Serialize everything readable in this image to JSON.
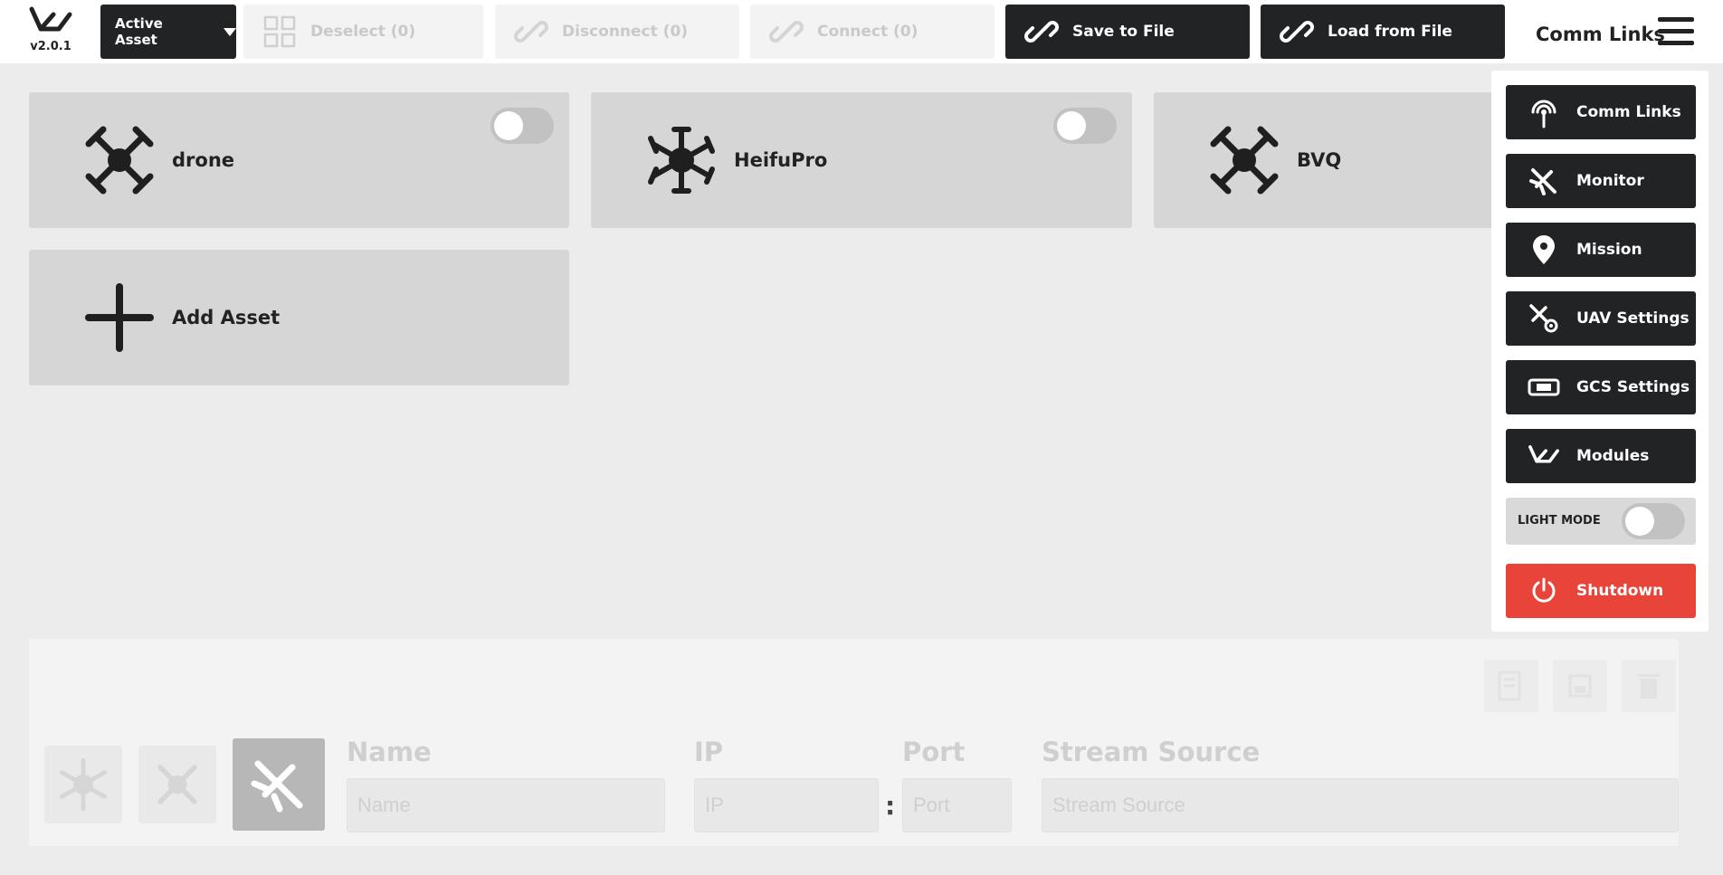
{
  "app": {
    "version": "v2.0.1"
  },
  "topbar": {
    "active_asset_label": "Active Asset",
    "deselect_label": "Deselect (0)",
    "disconnect_label": "Disconnect (0)",
    "connect_label": "Connect (0)",
    "save_label": "Save to File",
    "load_label": "Load from File",
    "menu_title": "Comm Links"
  },
  "assets": [
    {
      "name": "drone",
      "icon": "quadcopter-icon",
      "enabled": false
    },
    {
      "name": "HeifuPro",
      "icon": "hexacopter-icon",
      "enabled": false
    },
    {
      "name": "BVQ",
      "icon": "quadcopter-icon"
    }
  ],
  "add_asset_label": "Add Asset",
  "editor": {
    "name_label": "Name",
    "name_placeholder": "Name",
    "ip_label": "IP",
    "ip_placeholder": "IP",
    "port_label": "Port",
    "port_placeholder": "Port",
    "stream_label": "Stream Source",
    "stream_placeholder": "Stream Source",
    "separator": ":"
  },
  "menu": {
    "items": [
      {
        "label": "Comm Links",
        "icon": "antenna-icon"
      },
      {
        "label": "Monitor",
        "icon": "monitor-plane-icon"
      },
      {
        "label": "Mission",
        "icon": "map-pin-icon"
      },
      {
        "label": "UAV Settings",
        "icon": "uav-settings-icon"
      },
      {
        "label": "GCS Settings",
        "icon": "gcs-controller-icon"
      },
      {
        "label": "Modules",
        "icon": "modules-logo-icon"
      }
    ],
    "light_mode_label": "LIGHT MODE",
    "light_mode_on": false,
    "shutdown_label": "Shutdown"
  },
  "colors": {
    "dark": "#222325",
    "shutdown": "#e8443a",
    "card": "#d6d6d6",
    "background": "#ececec"
  }
}
